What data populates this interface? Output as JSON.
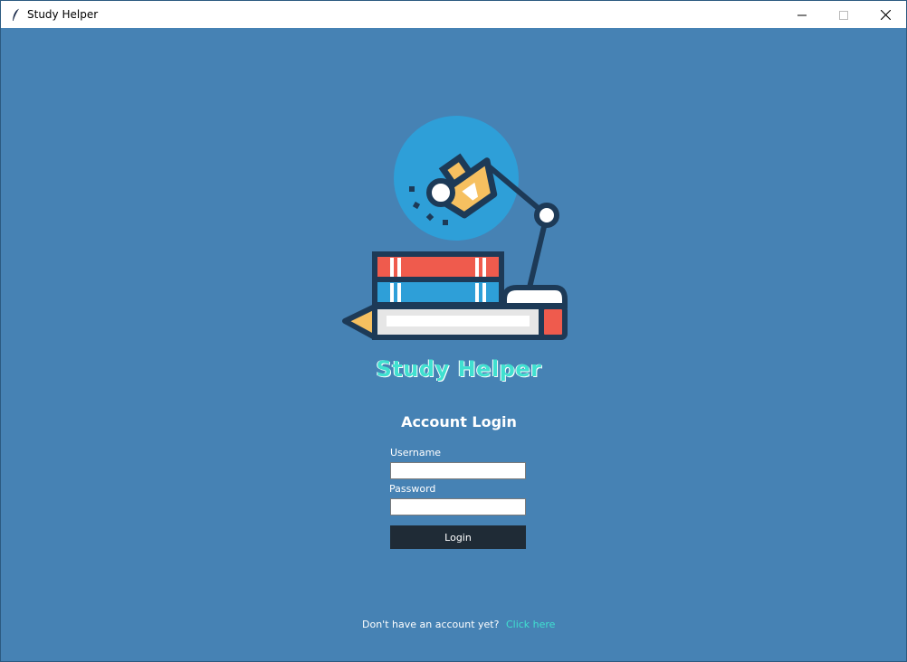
{
  "window": {
    "title": "Study Helper",
    "controls": {
      "minimize_icon": "minimize-icon",
      "maximize_icon": "maximize-icon",
      "close_icon": "close-icon"
    }
  },
  "logo": {
    "icon": "desk-lamp-books-pencil-illustration"
  },
  "brand": {
    "name": "Study Helper"
  },
  "login": {
    "heading": "Account Login",
    "username_label": "Username",
    "username_value": "",
    "password_label": "Password",
    "password_value": "",
    "button_label": "Login"
  },
  "footer": {
    "prompt": "Don't have an account yet?",
    "link": "Click here"
  },
  "colors": {
    "background": "#4682b4",
    "brand_text": "#40e0d0",
    "button_bg": "#1f2b36",
    "link": "#40e0d0"
  }
}
